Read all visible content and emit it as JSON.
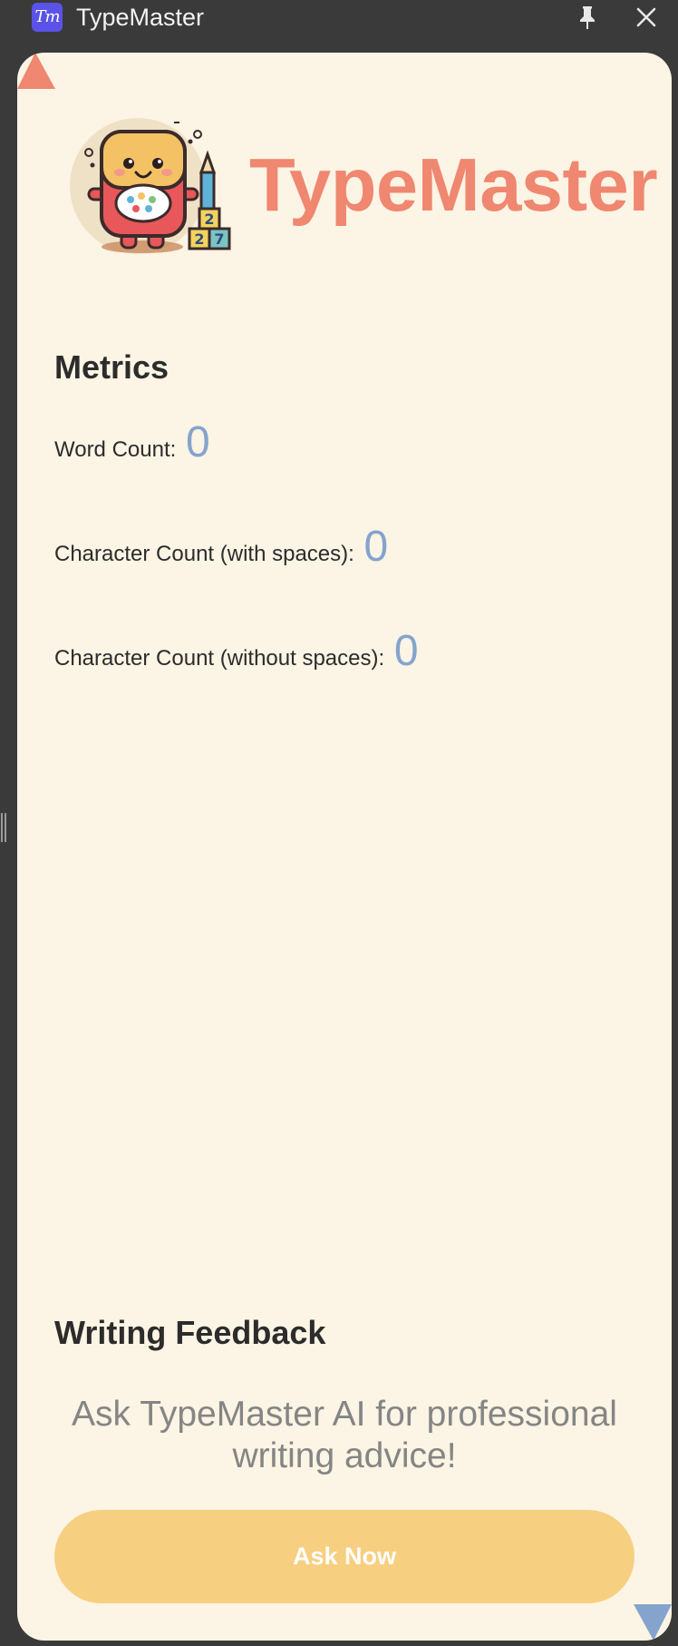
{
  "window": {
    "title": "TypeMaster",
    "app_icon_text": "Tm"
  },
  "header": {
    "brand_title": "TypeMaster"
  },
  "metrics": {
    "heading": "Metrics",
    "items": [
      {
        "label": "Word Count:",
        "value": "0"
      },
      {
        "label": "Character Count (with spaces):",
        "value": "0"
      },
      {
        "label": "Character Count (without spaces):",
        "value": "0"
      }
    ]
  },
  "feedback": {
    "heading": "Writing Feedback",
    "prompt": "Ask TypeMaster AI for professional writing advice!",
    "button_label": "Ask Now"
  },
  "colors": {
    "accent_title": "#f08770",
    "metric_value": "#85a4cd",
    "button_bg": "#f7cf80",
    "panel_bg": "#fcf4e4",
    "corner_top_left": "#f08770",
    "corner_bottom_right": "#85a4cd"
  },
  "icons": [
    "app-logo-icon",
    "pin-icon",
    "close-icon",
    "mascot-logo-icon"
  ]
}
